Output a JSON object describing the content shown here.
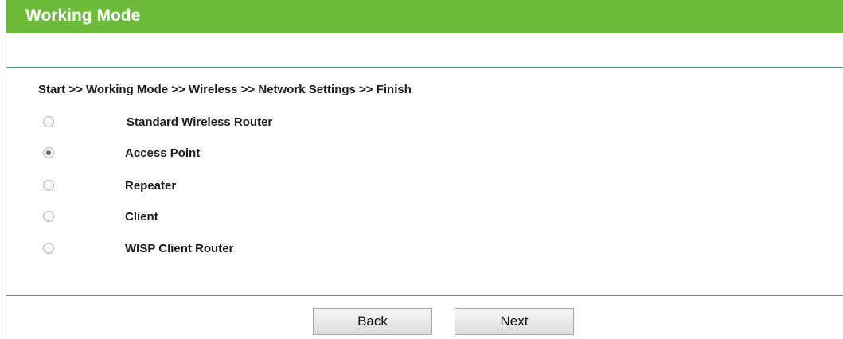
{
  "header": {
    "title": "Working Mode"
  },
  "breadcrumb": "Start >> Working Mode >> Wireless >> Network Settings >> Finish",
  "options": [
    {
      "label": "Standard Wireless Router",
      "selected": false
    },
    {
      "label": "Access Point",
      "selected": true
    },
    {
      "label": "Repeater",
      "selected": false
    },
    {
      "label": "Client",
      "selected": false
    },
    {
      "label": "WISP Client Router",
      "selected": false
    }
  ],
  "buttons": {
    "back": "Back",
    "next": "Next"
  },
  "colors": {
    "header_bg": "#6dbb3a",
    "divider": "#4a9a6a"
  }
}
